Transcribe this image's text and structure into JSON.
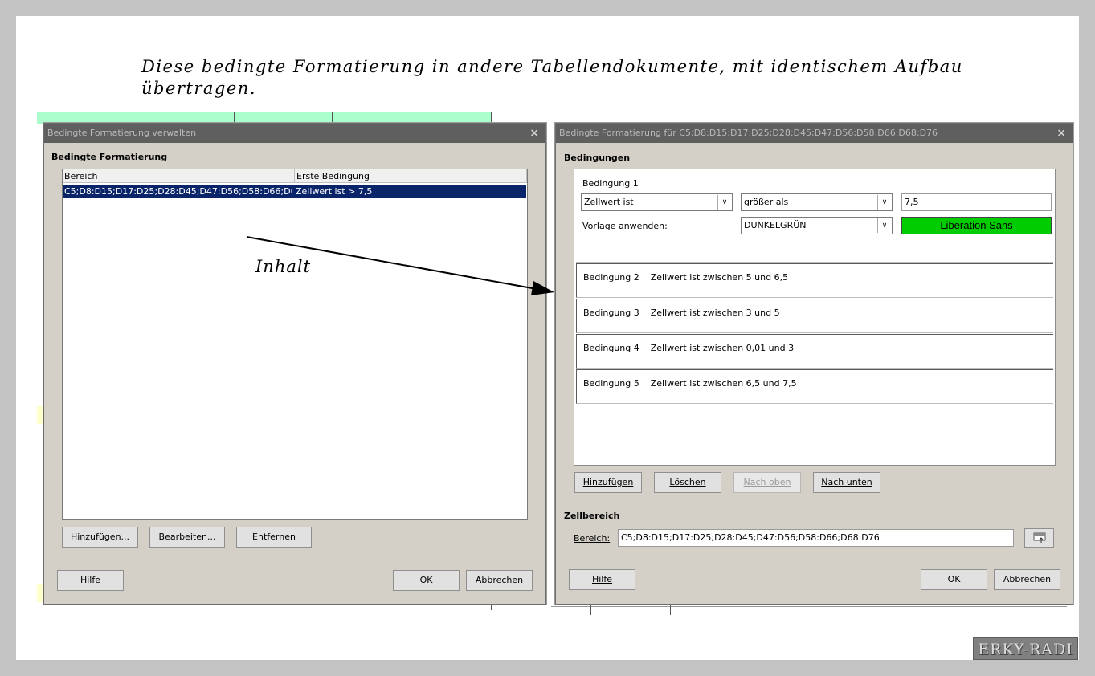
{
  "caption": {
    "line1": "Diese bedingte Formatierung in andere Tabellendokumente, mit identischem Aufbau",
    "line2": "übertragen."
  },
  "annotation": "Inhalt",
  "watermark": "ERKY-RADI",
  "dialog_manage": {
    "title": "Bedingte Formatierung verwalten",
    "section": "Bedingte Formatierung",
    "columns": [
      "Bereich",
      "Erste Bedingung"
    ],
    "row": {
      "range": "C5;D8:D15;D17:D25;D28:D45;D47:D56;D58:D66;D68:D76",
      "condition": "Zellwert ist > 7,5"
    },
    "buttons": {
      "add": "Hinzufügen...",
      "edit": "Bearbeiten...",
      "remove": "Entfernen",
      "help": "Hilfe",
      "ok": "OK",
      "cancel": "Abbrechen"
    }
  },
  "dialog_cond": {
    "title": "Bedingte Formatierung für C5;D8:D15;D17:D25;D28:D45;D47:D56;D58:D66;D68:D76",
    "section": "Bedingungen",
    "cond1": {
      "label": "Bedingung 1",
      "type": "Zellwert ist",
      "operator": "größer als",
      "value": "7,5",
      "style_label": "Vorlage anwenden:",
      "style": "DUNKELGRÜN",
      "preview": "Liberation Sans"
    },
    "conditions": [
      {
        "label": "Bedingung 2",
        "text": "Zellwert ist zwischen 5 und 6,5"
      },
      {
        "label": "Bedingung 3",
        "text": "Zellwert ist zwischen 3 und 5"
      },
      {
        "label": "Bedingung 4",
        "text": "Zellwert ist zwischen 0,01 und 3"
      },
      {
        "label": "Bedingung 5",
        "text": "Zellwert ist zwischen 6,5 und 7,5"
      }
    ],
    "buttons": {
      "add": "Hinzufügen",
      "delete": "Löschen",
      "up": "Nach oben",
      "down": "Nach unten",
      "help": "Hilfe",
      "ok": "OK",
      "cancel": "Abbrechen"
    },
    "cellrange_section": "Zellbereich",
    "range_label": "Bereich:",
    "range_value": "C5;D8:D15;D17:D25;D28:D45;D47:D56;D58:D66;D68:D76"
  },
  "colors": {
    "preview_bg": "#00cc00",
    "selection": "#0a246a",
    "titlebar": "#5f5f5f"
  }
}
